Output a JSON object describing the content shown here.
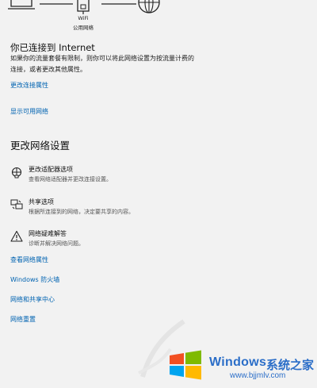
{
  "network_status": {
    "adapter_type": "WiFi",
    "network_profile": "公用网络",
    "connected_title": "你已连接到 Internet",
    "description_line1": "如果你的流量套餐有限制，则你可以将此网络设置为按流量计费的",
    "description_line2": "连接，或者更改其他属性。",
    "change_properties_link": "更改连接属性",
    "show_networks_link": "显示可用网络"
  },
  "advanced": {
    "heading": "更改网络设置",
    "options": [
      {
        "icon": "adapter-icon",
        "title": "更改适配器选项",
        "desc": "查看网络适配器并更改连接设置。"
      },
      {
        "icon": "sharing-icon",
        "title": "共享选项",
        "desc": "根据所连接到的网络，决定要共享的内容。"
      },
      {
        "icon": "warning-icon",
        "title": "网络疑难解答",
        "desc": "诊断并解决网络问题。"
      }
    ]
  },
  "links": [
    "查看网络属性",
    "Windows 防火墙",
    "网络和共享中心",
    "网络重置"
  ],
  "watermark": {
    "brand": "Windows",
    "brand_cn": "系统之家",
    "url": "www.bjjmlv.com"
  },
  "colors": {
    "link": "#0063b1",
    "background": "#f2f2f2",
    "watermark": "#2b6ec8"
  }
}
